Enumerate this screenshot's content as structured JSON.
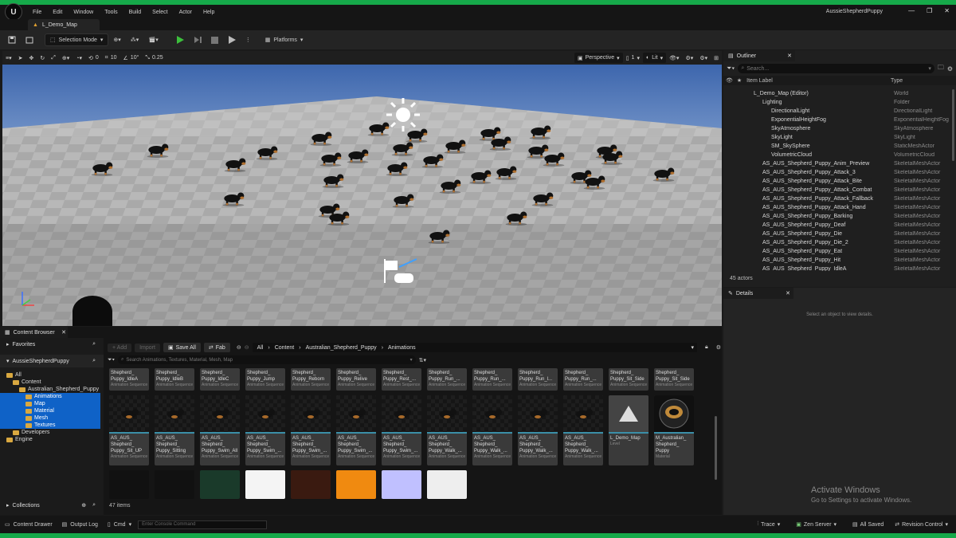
{
  "menubar": {
    "items": [
      "File",
      "Edit",
      "Window",
      "Tools",
      "Build",
      "Select",
      "Actor",
      "Help"
    ],
    "app_title": "AussieShepherdPuppy"
  },
  "tab": {
    "label": "L_Demo_Map"
  },
  "toolbar": {
    "selection_mode": "Selection Mode",
    "platforms": "Platforms"
  },
  "viewport_toolbar": {
    "rotate_snap": "0",
    "grid_snap": "10",
    "angle_snap": "10°",
    "scale_snap": "0.25",
    "perspective": "Perspective",
    "lit": "Lit",
    "show": "1"
  },
  "outliner": {
    "title": "Outliner",
    "search_placeholder": "Search...",
    "col_label": "Item Label",
    "col_type": "Type",
    "rows": [
      {
        "label": "L_Demo_Map (Editor)",
        "type": "World",
        "indent": 0
      },
      {
        "label": "Lighting",
        "type": "Folder",
        "indent": 1
      },
      {
        "label": "DirectionalLight",
        "type": "DirectionalLight",
        "indent": 2
      },
      {
        "label": "ExponentialHeightFog",
        "type": "ExponentialHeightFog",
        "indent": 2
      },
      {
        "label": "SkyAtmosphere",
        "type": "SkyAtmosphere",
        "indent": 2
      },
      {
        "label": "SkyLight",
        "type": "SkyLight",
        "indent": 2
      },
      {
        "label": "SM_SkySphere",
        "type": "StaticMeshActor",
        "indent": 2
      },
      {
        "label": "VolumetricCloud",
        "type": "VolumetricCloud",
        "indent": 2
      },
      {
        "label": "AS_AUS_Shepherd_Puppy_Anim_Preview",
        "type": "SkeletalMeshActor",
        "indent": 1
      },
      {
        "label": "AS_AUS_Shepherd_Puppy_Attack_3",
        "type": "SkeletalMeshActor",
        "indent": 1
      },
      {
        "label": "AS_AUS_Shepherd_Puppy_Attack_Bite",
        "type": "SkeletalMeshActor",
        "indent": 1
      },
      {
        "label": "AS_AUS_Shepherd_Puppy_Attack_Combat",
        "type": "SkeletalMeshActor",
        "indent": 1
      },
      {
        "label": "AS_AUS_Shepherd_Puppy_Attack_Fallback",
        "type": "SkeletalMeshActor",
        "indent": 1
      },
      {
        "label": "AS_AUS_Shepherd_Puppy_Attack_Hand",
        "type": "SkeletalMeshActor",
        "indent": 1
      },
      {
        "label": "AS_AUS_Shepherd_Puppy_Barking",
        "type": "SkeletalMeshActor",
        "indent": 1
      },
      {
        "label": "AS_AUS_Shepherd_Puppy_Deaf",
        "type": "SkeletalMeshActor",
        "indent": 1
      },
      {
        "label": "AS_AUS_Shepherd_Puppy_Die",
        "type": "SkeletalMeshActor",
        "indent": 1
      },
      {
        "label": "AS_AUS_Shepherd_Puppy_Die_2",
        "type": "SkeletalMeshActor",
        "indent": 1
      },
      {
        "label": "AS_AUS_Shepherd_Puppy_Eat",
        "type": "SkeletalMeshActor",
        "indent": 1
      },
      {
        "label": "AS_AUS_Shepherd_Puppy_Hit",
        "type": "SkeletalMeshActor",
        "indent": 1
      },
      {
        "label": "AS_AUS_Shepherd_Puppy_IdleA",
        "type": "SkeletalMeshActor",
        "indent": 1
      }
    ],
    "actor_count": "45 actors"
  },
  "details": {
    "title": "Details",
    "empty_message": "Select an object to view details."
  },
  "content_browser": {
    "title": "Content Browser",
    "favorites": "Favorites",
    "project": "AussieShepherdPuppy",
    "collections": "Collections",
    "add": "+ Add",
    "import": "Import",
    "save_all": "Save All",
    "fab": "Fab",
    "breadcrumb": [
      "All",
      "Content",
      "Australian_Shepherd_Puppy",
      "Animations"
    ],
    "search_placeholder": "Search Animations, Textures, Material, Mesh, Map",
    "item_count": "47 items",
    "tree": [
      {
        "label": "All",
        "indent": 0
      },
      {
        "label": "Content",
        "indent": 1
      },
      {
        "label": "Australian_Shepherd_Puppy",
        "indent": 2
      },
      {
        "label": "Animations",
        "indent": 3,
        "selected": true
      },
      {
        "label": "Map",
        "indent": 3,
        "selected": true
      },
      {
        "label": "Material",
        "indent": 3,
        "selected": true
      },
      {
        "label": "Mesh",
        "indent": 3,
        "selected": true
      },
      {
        "label": "Textures",
        "indent": 3,
        "selected": true
      },
      {
        "label": "Developers",
        "indent": 1
      },
      {
        "label": "Engine",
        "indent": 0
      }
    ],
    "row1": [
      {
        "name": "Shepherd_ Puppy_IdleA",
        "type": "Animation Sequence"
      },
      {
        "name": "Shepherd_ Puppy_IdleB",
        "type": "Animation Sequence"
      },
      {
        "name": "Shepherd_ Puppy_IdleC",
        "type": "Animation Sequence"
      },
      {
        "name": "Shepherd_ Puppy_Jump",
        "type": "Animation Sequence"
      },
      {
        "name": "Shepherd_ Puppy_Reborn",
        "type": "Animation Sequence"
      },
      {
        "name": "Shepherd_ Puppy_Relive",
        "type": "Animation Sequence"
      },
      {
        "name": "Shepherd_ Puppy_Rest_...",
        "type": "Animation Sequence"
      },
      {
        "name": "Shepherd_ Puppy_Run_...",
        "type": "Animation Sequence"
      },
      {
        "name": "Shepherd_ Puppy_Run_...",
        "type": "Animation Sequence"
      },
      {
        "name": "Shepherd_ Puppy_Run_l...",
        "type": "Animation Sequence"
      },
      {
        "name": "Shepherd_ Puppy_Run_...",
        "type": "Animation Sequence"
      },
      {
        "name": "Shepherd_ Puppy_Sit_Side",
        "type": "Animation Sequence"
      },
      {
        "name": "Shepherd_ Puppy_Sit_Side",
        "type": "Animation Sequence"
      }
    ],
    "row2": [
      {
        "name": "AS_AUS_ Shepherd_ Puppy_Sit_UP",
        "type": "Animation Sequence"
      },
      {
        "name": "AS_AUS_ Shepherd_ Puppy_Sitting",
        "type": "Animation Sequence"
      },
      {
        "name": "AS_AUS_ Shepherd_ Puppy_Swim_All",
        "type": "Animation Sequence"
      },
      {
        "name": "AS_AUS_ Shepherd_ Puppy_Swim_...",
        "type": "Animation Sequence"
      },
      {
        "name": "AS_AUS_ Shepherd_ Puppy_Swim_...",
        "type": "Animation Sequence"
      },
      {
        "name": "AS_AUS_ Shepherd_ Puppy_Swim_...",
        "type": "Animation Sequence"
      },
      {
        "name": "AS_AUS_ Shepherd_ Puppy_Swim_...",
        "type": "Animation Sequence"
      },
      {
        "name": "AS_AUS_ Shepherd_ Puppy_Walk_...",
        "type": "Animation Sequence"
      },
      {
        "name": "AS_AUS_ Shepherd_ Puppy_Walk_...",
        "type": "Animation Sequence"
      },
      {
        "name": "AS_AUS_ Shepherd_ Puppy_Walk_...",
        "type": "Animation Sequence"
      },
      {
        "name": "AS_AUS_ Shepherd_ Puppy_Walk_...",
        "type": "Animation Sequence"
      },
      {
        "name": "L_Demo_Map",
        "type": "Level"
      },
      {
        "name": "M_Australian_ Shepherd_ Puppy",
        "type": "Material"
      }
    ]
  },
  "statusbar": {
    "content_drawer": "Content Drawer",
    "output_log": "Output Log",
    "cmd": "Cmd",
    "console_placeholder": "Enter Console Command",
    "trace": "Trace",
    "zen_server": "Zen Server",
    "all_saved": "All Saved",
    "revision_control": "Revision Control"
  },
  "watermark": {
    "line1": "Activate Windows",
    "line2": "Go to Settings to activate Windows."
  },
  "colors": {
    "accent": "#0f62c7",
    "frame_green": "#16a94a",
    "play_green": "#3cbf3c",
    "folder": "#d9a840"
  }
}
